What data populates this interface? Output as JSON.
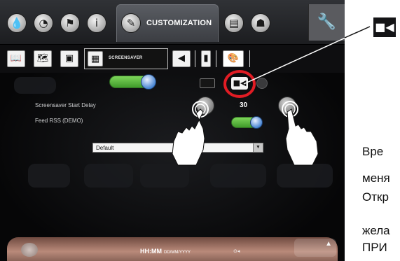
{
  "topbar": {
    "tabs": [
      {
        "icon": "water-drop-icon"
      },
      {
        "icon": "clock-icon"
      },
      {
        "icon": "flag-icon"
      },
      {
        "icon": "info-icon"
      },
      {
        "icon": "brush-icon",
        "label": "CUSTOMIZATION"
      },
      {
        "icon": "calendar-icon"
      },
      {
        "icon": "user-icon"
      }
    ],
    "settings_icon": "wrench-icon"
  },
  "subbar": {
    "items": [
      {
        "icon": "book-icon"
      },
      {
        "icon": "book-map-icon"
      },
      {
        "icon": "screen-image-icon"
      },
      {
        "icon": "screensaver-icon",
        "label": "SCREENSAVER"
      },
      {
        "icon": "speaker-icon"
      },
      {
        "icon": "battery-icon"
      },
      {
        "icon": "palette-icon"
      }
    ]
  },
  "settings": {
    "screensaver_enabled": true,
    "modes": [
      "monitor-icon",
      "video-camera-icon",
      "next-icon"
    ],
    "selected_mode": "video-camera-icon",
    "start_delay_label": "Screensaver Start Delay",
    "start_delay_value": "30",
    "feed_rss_label": "Feed RSS (DEMO)",
    "feed_rss_enabled": true,
    "feed_select_value": "Default"
  },
  "bottombar": {
    "clock_format": "HH:MM",
    "date_format": "DD/MM/YYYY"
  },
  "callout": {
    "icon": "video-camera-icon"
  },
  "side_text": {
    "line1": "Вре",
    "line2": "меня",
    "line3": "Откр",
    "line4": "жела",
    "line5": "ПРИ"
  },
  "colors": {
    "highlight": "#e11c24",
    "toggle_on": "#5ab33b",
    "accent_blue": "#3f7fd0"
  }
}
